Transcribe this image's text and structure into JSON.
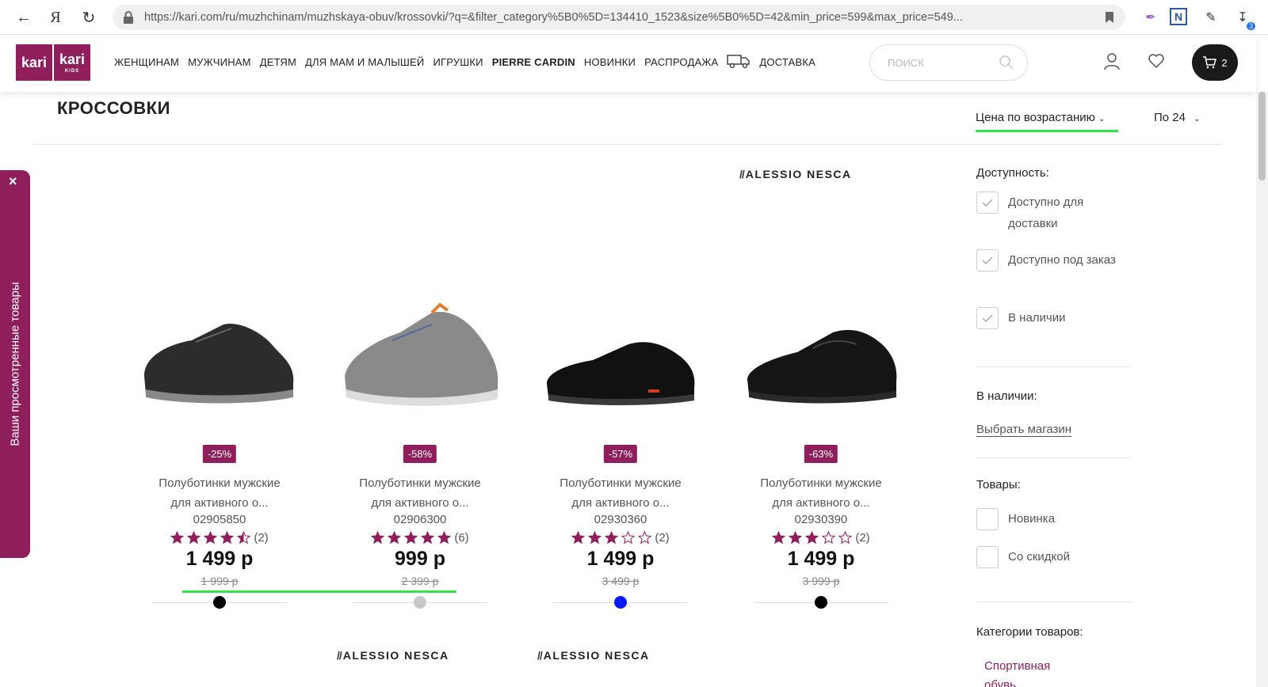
{
  "browser": {
    "url": "https://kari.com/ru/muzhchinam/muzhskaya-obuv/krossovki/?q=&filter_category%5B0%5D=134410_1523&size%5B0%5D=42&min_price=599&max_price=549...",
    "downloads_badge": "3"
  },
  "header": {
    "logo_text_1": "kari",
    "logo_text_2": "kari",
    "logo_sub": "KIDS",
    "menu": [
      "ЖЕНЩИНАМ",
      "МУЖЧИНАМ",
      "ДЕТЯМ",
      "ДЛЯ МАМ И МАЛЫШЕЙ",
      "ИГРУШКИ",
      "PIERRE CARDIN",
      "НОВИНКИ",
      "РАСПРОДАЖА",
      "ДОСТАВКА"
    ],
    "search_placeholder": "ПОИСК",
    "cart_count": "2"
  },
  "page": {
    "title": "КРОССОВКИ",
    "sort_label": "Цена по возрастанию",
    "per_page_label": "По 24"
  },
  "viewed_panel": {
    "label": "Ваши просмотренные товары",
    "close": "×"
  },
  "brand_name": "ALESSIO NESCA",
  "products": [
    {
      "discount": "-25%",
      "name_line1": "Полуботинки мужские",
      "name_line2": "для активного о...",
      "code": "02905850",
      "rating": 4.5,
      "reviews": "(2)",
      "price": "1 499 р",
      "old_price": "1 999 р",
      "swatch_color": "#000000"
    },
    {
      "discount": "-58%",
      "name_line1": "Полуботинки мужские",
      "name_line2": "для активного о...",
      "code": "02906300",
      "rating": 5,
      "reviews": "(6)",
      "price": "999 р",
      "old_price": "2 399 р",
      "swatch_color": "#c8c8c8"
    },
    {
      "discount": "-57%",
      "name_line1": "Полуботинки мужские",
      "name_line2": "для активного о...",
      "code": "02930360",
      "rating": 3,
      "reviews": "(2)",
      "price": "1 499 р",
      "old_price": "3 499 р",
      "swatch_color": "#0a1aff"
    },
    {
      "discount": "-63%",
      "name_line1": "Полуботинки мужские",
      "name_line2": "для активного о...",
      "code": "02930390",
      "rating": 3,
      "reviews": "(2)",
      "price": "1 499 р",
      "old_price": "3 999 р",
      "swatch_color": "#000000"
    }
  ],
  "filters": {
    "availability_title": "Доступность:",
    "availability": [
      "Доступно для доставки",
      "Доступно под заказ",
      "В наличии"
    ],
    "in_stock_title": "В наличии:",
    "choose_store": "Выбрать магазин",
    "goods_title": "Товары:",
    "goods": [
      "Новинка",
      "Со скидкой"
    ],
    "categories_title": "Категории товаров:",
    "category_item": "Спортивная обувь"
  },
  "colors": {
    "brand": "#8e1f5c",
    "highlight": "#2ee64a"
  }
}
